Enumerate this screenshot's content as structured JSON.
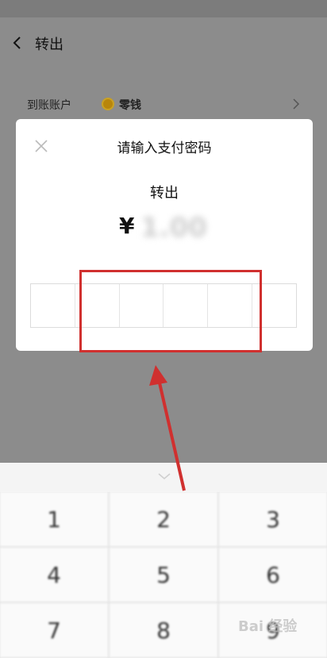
{
  "status": {
    "left": "",
    "right": ""
  },
  "header": {
    "title": "转出"
  },
  "account": {
    "label": "到账账户",
    "value": "零钱"
  },
  "modal": {
    "title": "请输入支付密码",
    "subtitle": "转出",
    "currency": "¥",
    "amount": "1.00",
    "pin_cells": 6
  },
  "keyboard": {
    "keys": [
      "1",
      "2",
      "3",
      "4",
      "5",
      "6",
      "7",
      "8",
      "9"
    ]
  },
  "watermark": {
    "text": "Bai 经验"
  },
  "colors": {
    "highlight": "#d0302f",
    "overlay": "#8c8c8c"
  }
}
